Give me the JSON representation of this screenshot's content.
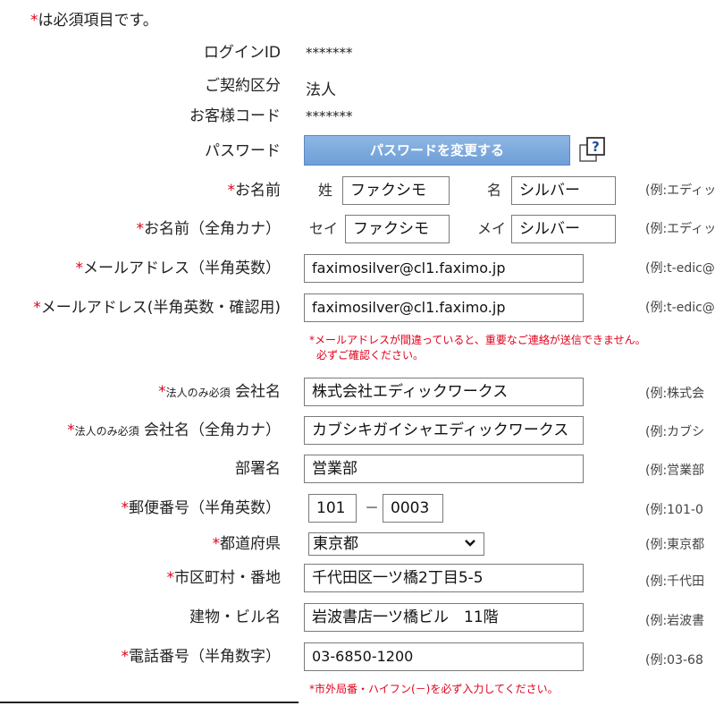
{
  "note": {
    "asterisk": "*",
    "text": "は必須項目です。"
  },
  "account": {
    "login_id_label": "ログインID",
    "login_id_value": "*******",
    "contract_label": "ご契約区分",
    "contract_value": "法人",
    "customer_code_label": "お客様コード",
    "customer_code_value": "*******",
    "password_label": "パスワード",
    "password_button": "パスワードを変更する"
  },
  "fields": {
    "name": {
      "label": "お名前",
      "sei_prefix": "姓",
      "sei_value": "ファクシモ",
      "mei_prefix": "名",
      "mei_value": "シルバー",
      "example": "(例:エディッ"
    },
    "kana": {
      "label": "お名前（全角カナ）",
      "sei_prefix": "セイ",
      "sei_value": "ファクシモ",
      "mei_prefix": "メイ",
      "mei_value": "シルバー",
      "example": "(例:エディッ"
    },
    "email": {
      "label": "メールアドレス（半角英数）",
      "value": "faximosilver@cl1.faximo.jp",
      "example": "(例:t-edic@"
    },
    "email_confirm": {
      "label": "メールアドレス(半角英数・確認用)",
      "value": "faximosilver@cl1.faximo.jp",
      "example": "(例:t-edic@"
    },
    "email_warning": [
      "*メールアドレスが間違っていると、重要なご連絡が送信できません。",
      "必ずご確認ください。"
    ],
    "company": {
      "tag": "法人のみ必須",
      "label": "会社名",
      "value": "株式会社エディックワークス",
      "example": "(例:株式会"
    },
    "company_kana": {
      "tag": "法人のみ必須",
      "label": "会社名（全角カナ）",
      "value": "カブシキガイシャエディックワークス",
      "example": "(例:カブシ"
    },
    "department": {
      "label": "部署名",
      "value": "営業部",
      "example": "(例:営業部"
    },
    "postal": {
      "label": "郵便番号（半角英数）",
      "value1": "101",
      "separator": "－",
      "value2": "0003",
      "example": "(例:101-0"
    },
    "prefecture": {
      "label": "都道府県",
      "value": "東京都",
      "example": "(例:東京都"
    },
    "city": {
      "label": "市区町村・番地",
      "value": "千代田区一ツ橋2丁目5-5",
      "example": "(例:千代田"
    },
    "building": {
      "label": "建物・ビル名",
      "value": "岩波書店一ツ橋ビル　11階",
      "example": "(例:岩波書"
    },
    "phone": {
      "label": "電話番号（半角数字）",
      "value": "03-6850-1200",
      "example": "(例:03-68"
    },
    "phone_warning": "*市外局番・ハイフン(－)を必ず入力してください。"
  },
  "colors": {
    "required": "#e0001b",
    "button": "#7aa8dc"
  }
}
